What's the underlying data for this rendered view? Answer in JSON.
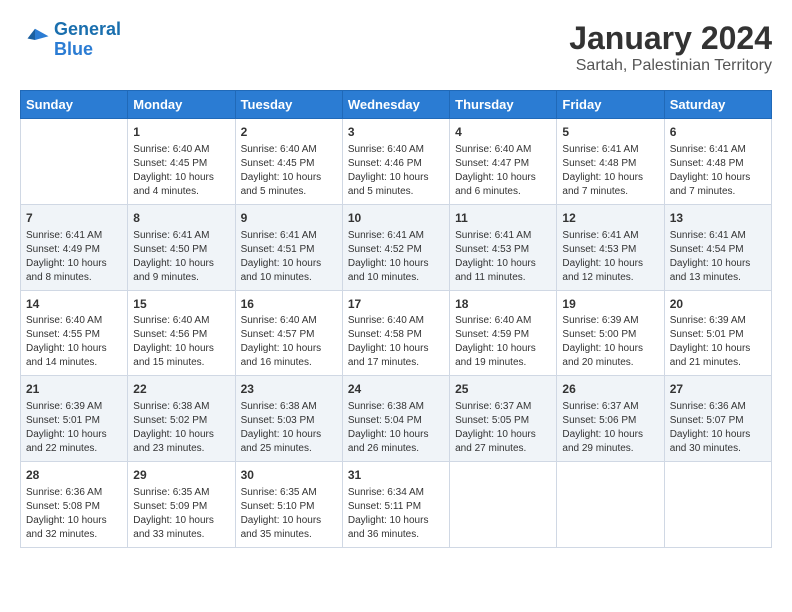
{
  "header": {
    "logo_line1": "General",
    "logo_line2": "Blue",
    "month_year": "January 2024",
    "location": "Sartah, Palestinian Territory"
  },
  "weekdays": [
    "Sunday",
    "Monday",
    "Tuesday",
    "Wednesday",
    "Thursday",
    "Friday",
    "Saturday"
  ],
  "weeks": [
    [
      {
        "day": "",
        "info": ""
      },
      {
        "day": "1",
        "info": "Sunrise: 6:40 AM\nSunset: 4:45 PM\nDaylight: 10 hours\nand 4 minutes."
      },
      {
        "day": "2",
        "info": "Sunrise: 6:40 AM\nSunset: 4:45 PM\nDaylight: 10 hours\nand 5 minutes."
      },
      {
        "day": "3",
        "info": "Sunrise: 6:40 AM\nSunset: 4:46 PM\nDaylight: 10 hours\nand 5 minutes."
      },
      {
        "day": "4",
        "info": "Sunrise: 6:40 AM\nSunset: 4:47 PM\nDaylight: 10 hours\nand 6 minutes."
      },
      {
        "day": "5",
        "info": "Sunrise: 6:41 AM\nSunset: 4:48 PM\nDaylight: 10 hours\nand 7 minutes."
      },
      {
        "day": "6",
        "info": "Sunrise: 6:41 AM\nSunset: 4:48 PM\nDaylight: 10 hours\nand 7 minutes."
      }
    ],
    [
      {
        "day": "7",
        "info": "Sunrise: 6:41 AM\nSunset: 4:49 PM\nDaylight: 10 hours\nand 8 minutes."
      },
      {
        "day": "8",
        "info": "Sunrise: 6:41 AM\nSunset: 4:50 PM\nDaylight: 10 hours\nand 9 minutes."
      },
      {
        "day": "9",
        "info": "Sunrise: 6:41 AM\nSunset: 4:51 PM\nDaylight: 10 hours\nand 10 minutes."
      },
      {
        "day": "10",
        "info": "Sunrise: 6:41 AM\nSunset: 4:52 PM\nDaylight: 10 hours\nand 10 minutes."
      },
      {
        "day": "11",
        "info": "Sunrise: 6:41 AM\nSunset: 4:53 PM\nDaylight: 10 hours\nand 11 minutes."
      },
      {
        "day": "12",
        "info": "Sunrise: 6:41 AM\nSunset: 4:53 PM\nDaylight: 10 hours\nand 12 minutes."
      },
      {
        "day": "13",
        "info": "Sunrise: 6:41 AM\nSunset: 4:54 PM\nDaylight: 10 hours\nand 13 minutes."
      }
    ],
    [
      {
        "day": "14",
        "info": "Sunrise: 6:40 AM\nSunset: 4:55 PM\nDaylight: 10 hours\nand 14 minutes."
      },
      {
        "day": "15",
        "info": "Sunrise: 6:40 AM\nSunset: 4:56 PM\nDaylight: 10 hours\nand 15 minutes."
      },
      {
        "day": "16",
        "info": "Sunrise: 6:40 AM\nSunset: 4:57 PM\nDaylight: 10 hours\nand 16 minutes."
      },
      {
        "day": "17",
        "info": "Sunrise: 6:40 AM\nSunset: 4:58 PM\nDaylight: 10 hours\nand 17 minutes."
      },
      {
        "day": "18",
        "info": "Sunrise: 6:40 AM\nSunset: 4:59 PM\nDaylight: 10 hours\nand 19 minutes."
      },
      {
        "day": "19",
        "info": "Sunrise: 6:39 AM\nSunset: 5:00 PM\nDaylight: 10 hours\nand 20 minutes."
      },
      {
        "day": "20",
        "info": "Sunrise: 6:39 AM\nSunset: 5:01 PM\nDaylight: 10 hours\nand 21 minutes."
      }
    ],
    [
      {
        "day": "21",
        "info": "Sunrise: 6:39 AM\nSunset: 5:01 PM\nDaylight: 10 hours\nand 22 minutes."
      },
      {
        "day": "22",
        "info": "Sunrise: 6:38 AM\nSunset: 5:02 PM\nDaylight: 10 hours\nand 23 minutes."
      },
      {
        "day": "23",
        "info": "Sunrise: 6:38 AM\nSunset: 5:03 PM\nDaylight: 10 hours\nand 25 minutes."
      },
      {
        "day": "24",
        "info": "Sunrise: 6:38 AM\nSunset: 5:04 PM\nDaylight: 10 hours\nand 26 minutes."
      },
      {
        "day": "25",
        "info": "Sunrise: 6:37 AM\nSunset: 5:05 PM\nDaylight: 10 hours\nand 27 minutes."
      },
      {
        "day": "26",
        "info": "Sunrise: 6:37 AM\nSunset: 5:06 PM\nDaylight: 10 hours\nand 29 minutes."
      },
      {
        "day": "27",
        "info": "Sunrise: 6:36 AM\nSunset: 5:07 PM\nDaylight: 10 hours\nand 30 minutes."
      }
    ],
    [
      {
        "day": "28",
        "info": "Sunrise: 6:36 AM\nSunset: 5:08 PM\nDaylight: 10 hours\nand 32 minutes."
      },
      {
        "day": "29",
        "info": "Sunrise: 6:35 AM\nSunset: 5:09 PM\nDaylight: 10 hours\nand 33 minutes."
      },
      {
        "day": "30",
        "info": "Sunrise: 6:35 AM\nSunset: 5:10 PM\nDaylight: 10 hours\nand 35 minutes."
      },
      {
        "day": "31",
        "info": "Sunrise: 6:34 AM\nSunset: 5:11 PM\nDaylight: 10 hours\nand 36 minutes."
      },
      {
        "day": "",
        "info": ""
      },
      {
        "day": "",
        "info": ""
      },
      {
        "day": "",
        "info": ""
      }
    ]
  ]
}
